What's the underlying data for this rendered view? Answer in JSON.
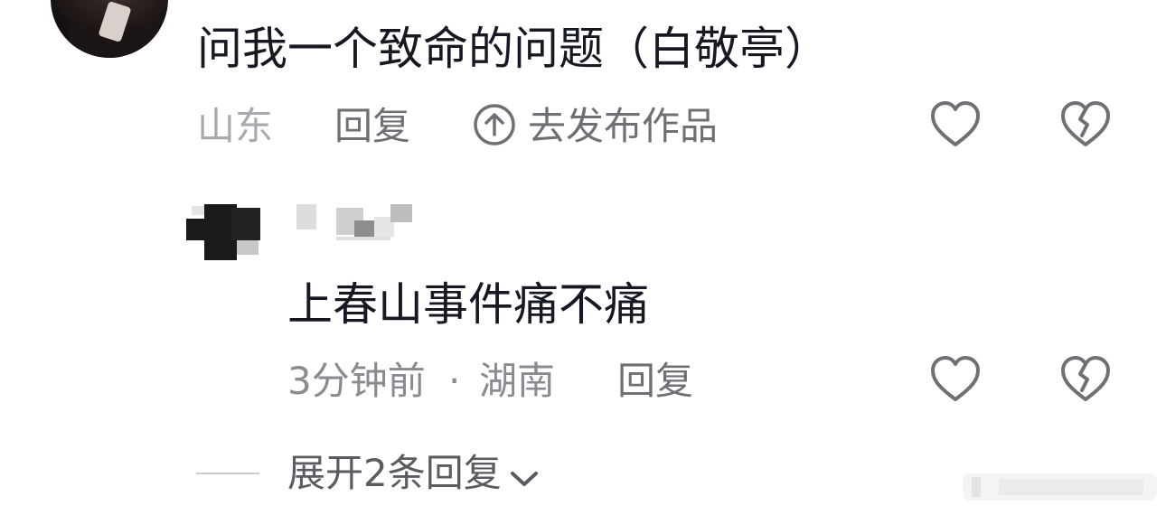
{
  "comment": {
    "text": "问我一个致命的问题（白敬亭）",
    "location": "山东",
    "reply_label": "回复",
    "publish_label": "去发布作品",
    "icons": [
      "arrow-up-circle-icon",
      "heart-icon",
      "broken-heart-icon"
    ]
  },
  "reply": {
    "text": "上春山事件痛不痛",
    "time": "3分钟前",
    "separator": "·",
    "location": "湖南",
    "reply_label": "回复",
    "icons": [
      "heart-icon",
      "broken-heart-icon"
    ]
  },
  "expand": {
    "label": "展开2条回复",
    "icon": "chevron-down-icon"
  },
  "colors": {
    "text_primary": "#161823",
    "text_secondary": "#8a8b91",
    "icon_gray": "#6f7075",
    "background": "#ffffff"
  }
}
